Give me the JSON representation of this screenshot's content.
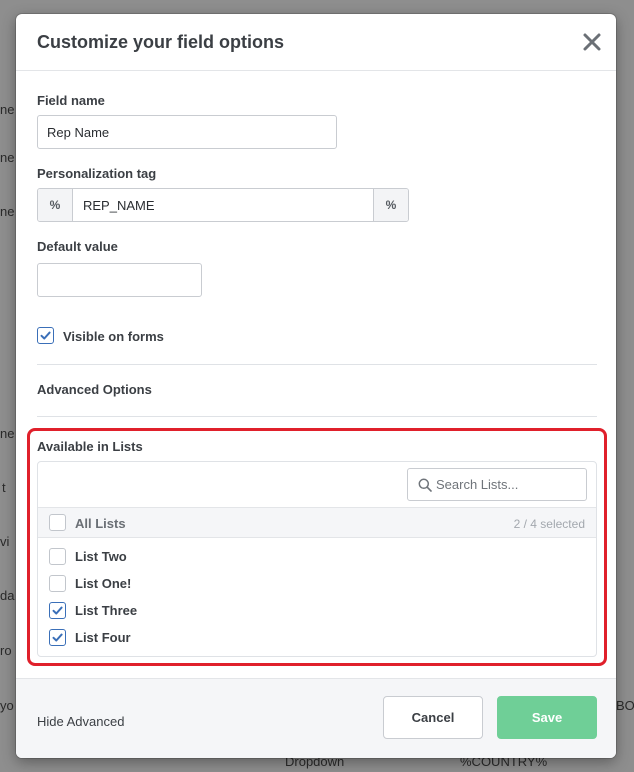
{
  "background": {
    "fragments": [
      "ne",
      "ne",
      "ne",
      "ne",
      "t",
      "vi",
      "da",
      "ro",
      "yo",
      "BO",
      "Dropdown",
      "%COUNTRY%"
    ]
  },
  "modal": {
    "title": "Customize your field options",
    "close_icon": "close-icon"
  },
  "field_name": {
    "label": "Field name",
    "value": "Rep Name"
  },
  "personalization_tag": {
    "label": "Personalization tag",
    "prefix": "%",
    "value": "REP_NAME",
    "suffix": "%"
  },
  "default_value": {
    "label": "Default value",
    "value": ""
  },
  "visible_on_forms": {
    "label": "Visible on forms",
    "checked": true
  },
  "advanced_options": {
    "label": "Advanced Options"
  },
  "available_lists": {
    "label": "Available in Lists",
    "search_placeholder": "Search Lists...",
    "all_label": "All Lists",
    "selected_count": "2 / 4 selected",
    "items": [
      {
        "label": "List Two",
        "checked": false
      },
      {
        "label": "List One!",
        "checked": false
      },
      {
        "label": "List Three",
        "checked": true
      },
      {
        "label": "List Four",
        "checked": true
      }
    ]
  },
  "footer": {
    "hide_advanced": "Hide Advanced",
    "cancel_label": "Cancel",
    "save_label": "Save"
  },
  "colors": {
    "accent_check": "#3a6fb8",
    "save_button": "#6fcf97",
    "highlight": "#e0202b"
  }
}
